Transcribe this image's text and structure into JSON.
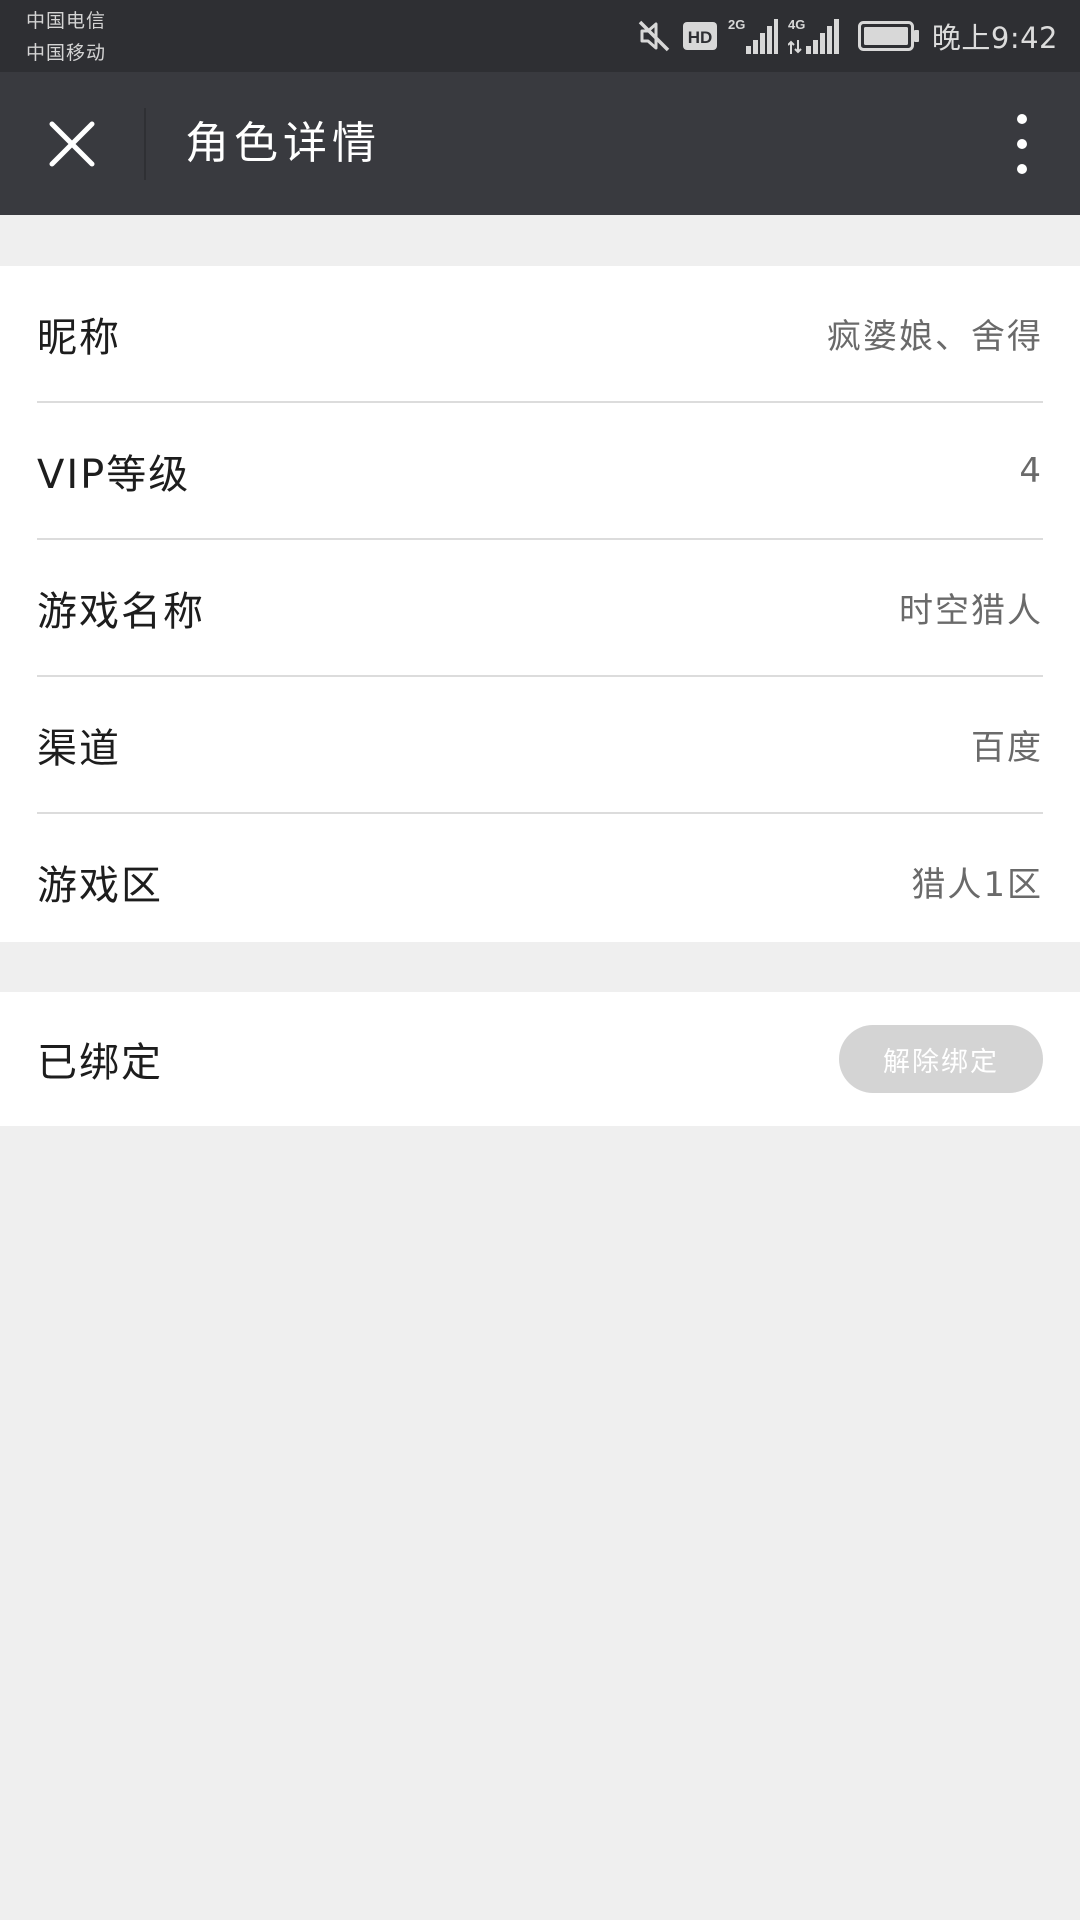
{
  "status_bar": {
    "carrier_1": "中国电信",
    "carrier_2": "中国移动",
    "icons": [
      "mute-icon",
      "hd-icon",
      "signal-2g-icon",
      "signal-4g-icon",
      "battery-icon"
    ],
    "hd_label": "HD",
    "net_2g_label": "2G",
    "net_4g_label": "4G",
    "time": "晚上9:42"
  },
  "header": {
    "title": "角色详情",
    "close_icon": "close-icon",
    "more_icon": "more-vertical-icon"
  },
  "details": [
    {
      "label": "昵称",
      "value": "疯婆娘、舍得"
    },
    {
      "label": "VIP等级",
      "value": "4"
    },
    {
      "label": "游戏名称",
      "value": "时空猎人"
    },
    {
      "label": "渠道",
      "value": "百度"
    },
    {
      "label": "游戏区",
      "value": "猎人1区"
    }
  ],
  "binding": {
    "status_label": "已绑定",
    "unbind_button": "解除绑定"
  },
  "colors": {
    "status_bar_bg": "#2e2f33",
    "title_bar_bg": "#393a3f",
    "page_bg": "#efefef",
    "card_bg": "#ffffff",
    "unbind_button_bg": "#d4d4d4"
  }
}
